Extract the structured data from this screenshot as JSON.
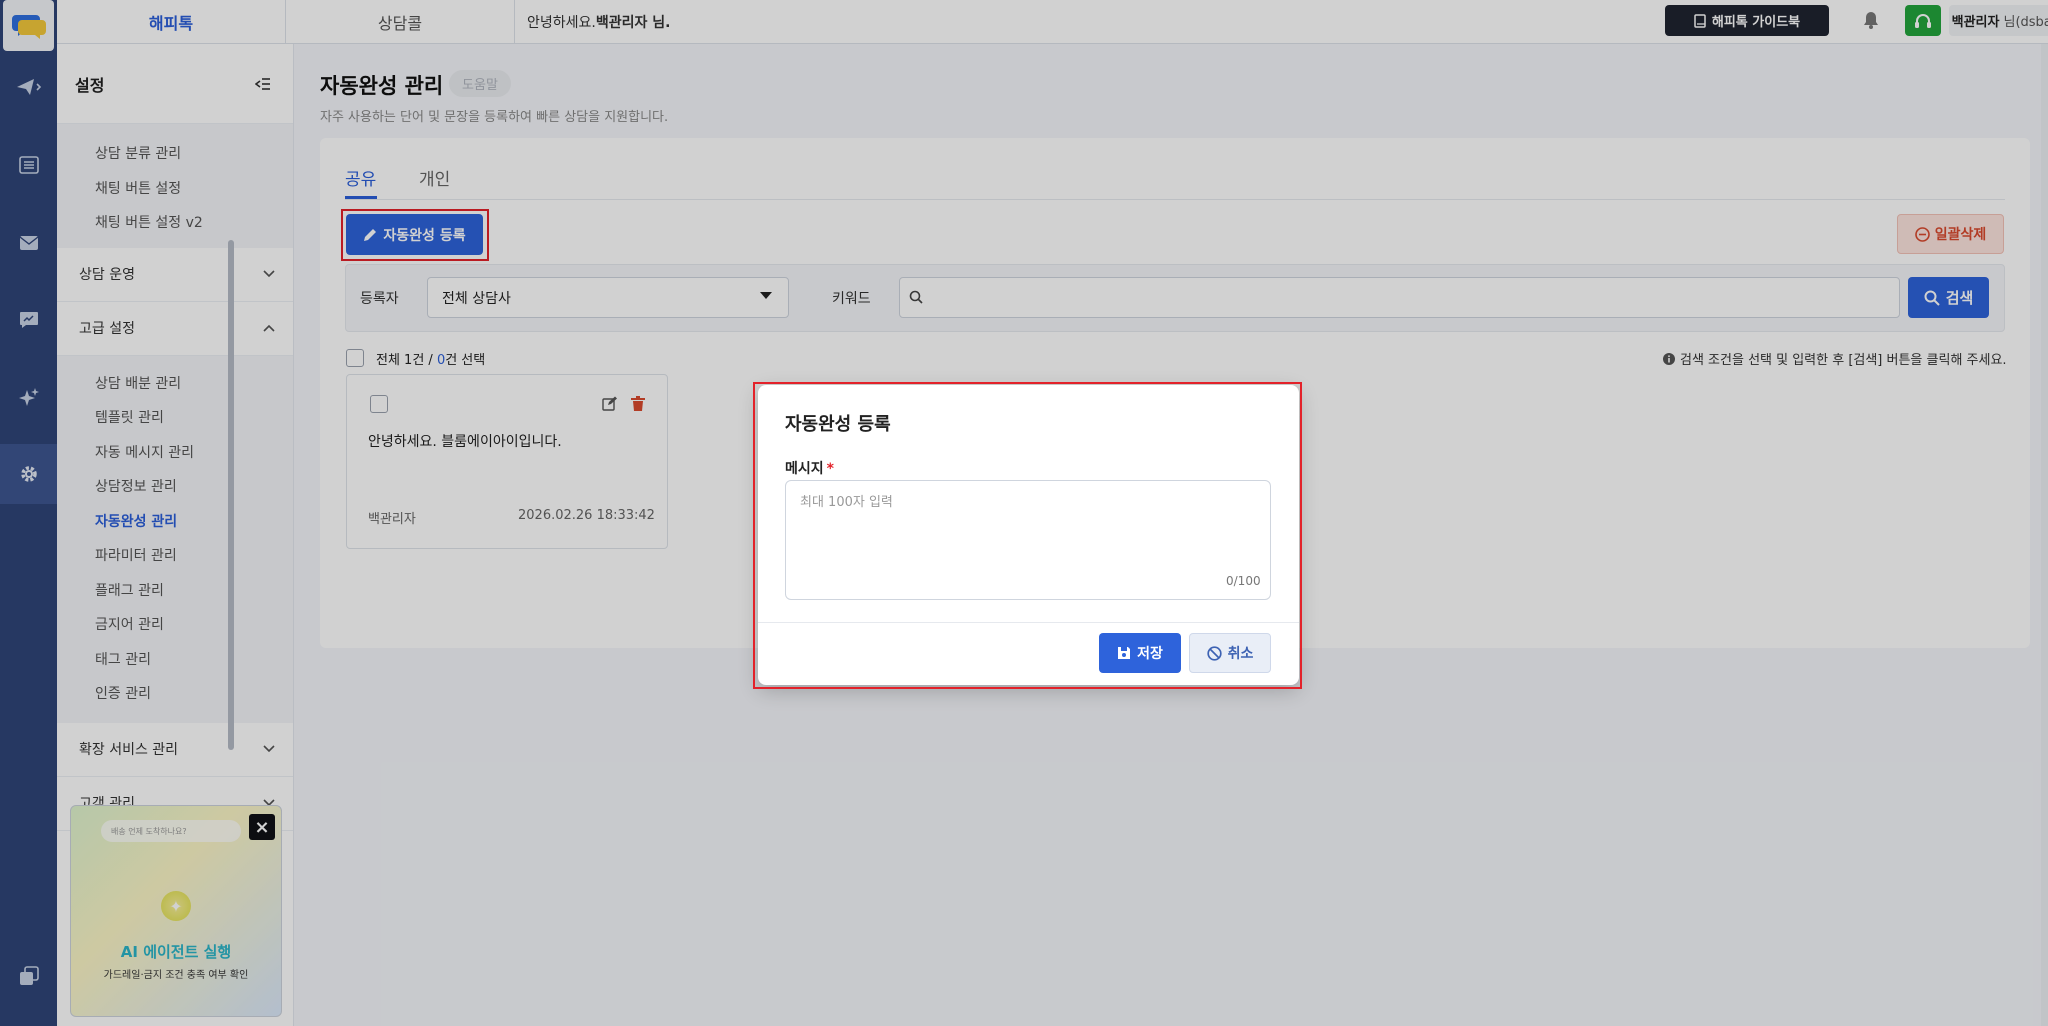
{
  "topbar": {
    "tabs": [
      "해피톡",
      "상담콜"
    ],
    "greeting_prefix": "안녕하세요.",
    "greeting_name": "백관리자 님.",
    "guide_button": "해피톡 가이드북",
    "user_name": "백관리자",
    "user_suffix": "님(dsbaek)"
  },
  "rail": {
    "icons": [
      "send-icon",
      "list-icon",
      "mail-icon",
      "chart-icon",
      "sparkle-icon",
      "settings-icon",
      "copy-icon"
    ]
  },
  "sidebar": {
    "title": "설정",
    "top_items": [
      "상담 분류 관리",
      "채팅 버튼 설정",
      "채팅 버튼 설정 v2"
    ],
    "groups": {
      "operation": "상담 운영",
      "advanced": "고급 설정",
      "extension": "확장 서비스 관리",
      "customer": "고객 관리"
    },
    "advanced_items": [
      "상담 배분 관리",
      "템플릿 관리",
      "자동 메시지 관리",
      "상담정보 관리",
      "자동완성 관리",
      "파라미터 관리",
      "플래그 관리",
      "금지어 관리",
      "태그 관리",
      "인증 관리"
    ],
    "active_item": "자동완성 관리"
  },
  "promo": {
    "mini_text": "배송 언제 도착하나요?",
    "title": "AI 에이전트 실행",
    "subtitle": "가드레일·금지 조건 충족 여부 확인"
  },
  "main": {
    "title": "자동완성 관리",
    "help_badge": "도움말",
    "description": "자주 사용하는 단어 및 문장을 등록하여 빠른 상담을 지원합니다.",
    "tabs": [
      "공유",
      "개인"
    ],
    "active_tab": "공유",
    "register_button": "자동완성 등록",
    "bulk_delete_button": "일괄삭제",
    "filter": {
      "registrant_label": "등록자",
      "registrant_value": "전체 상담사",
      "keyword_label": "키워드",
      "keyword_value": "",
      "search_button": "검색"
    },
    "count": {
      "total_prefix": "전체 1건 / ",
      "selected": "0",
      "selected_suffix": "건 선택"
    },
    "hint": "검색 조건을 선택 및 입력한 후 [검색] 버튼을 클릭해 주세요.",
    "items": [
      {
        "text": "안녕하세요. 블룸에이아이입니다.",
        "author": "백관리자",
        "date": "2026.02.26 18:33:42"
      }
    ]
  },
  "modal": {
    "title": "자동완성 등록",
    "message_label": "메시지",
    "required_mark": "*",
    "placeholder": "최대 100자 입력",
    "counter": "0/100",
    "save_button": "저장",
    "cancel_button": "취소"
  },
  "colors": {
    "accent": "#2e63db",
    "rail": "#2f4578",
    "danger": "#d94a2e",
    "highlight": "#e3222a"
  }
}
